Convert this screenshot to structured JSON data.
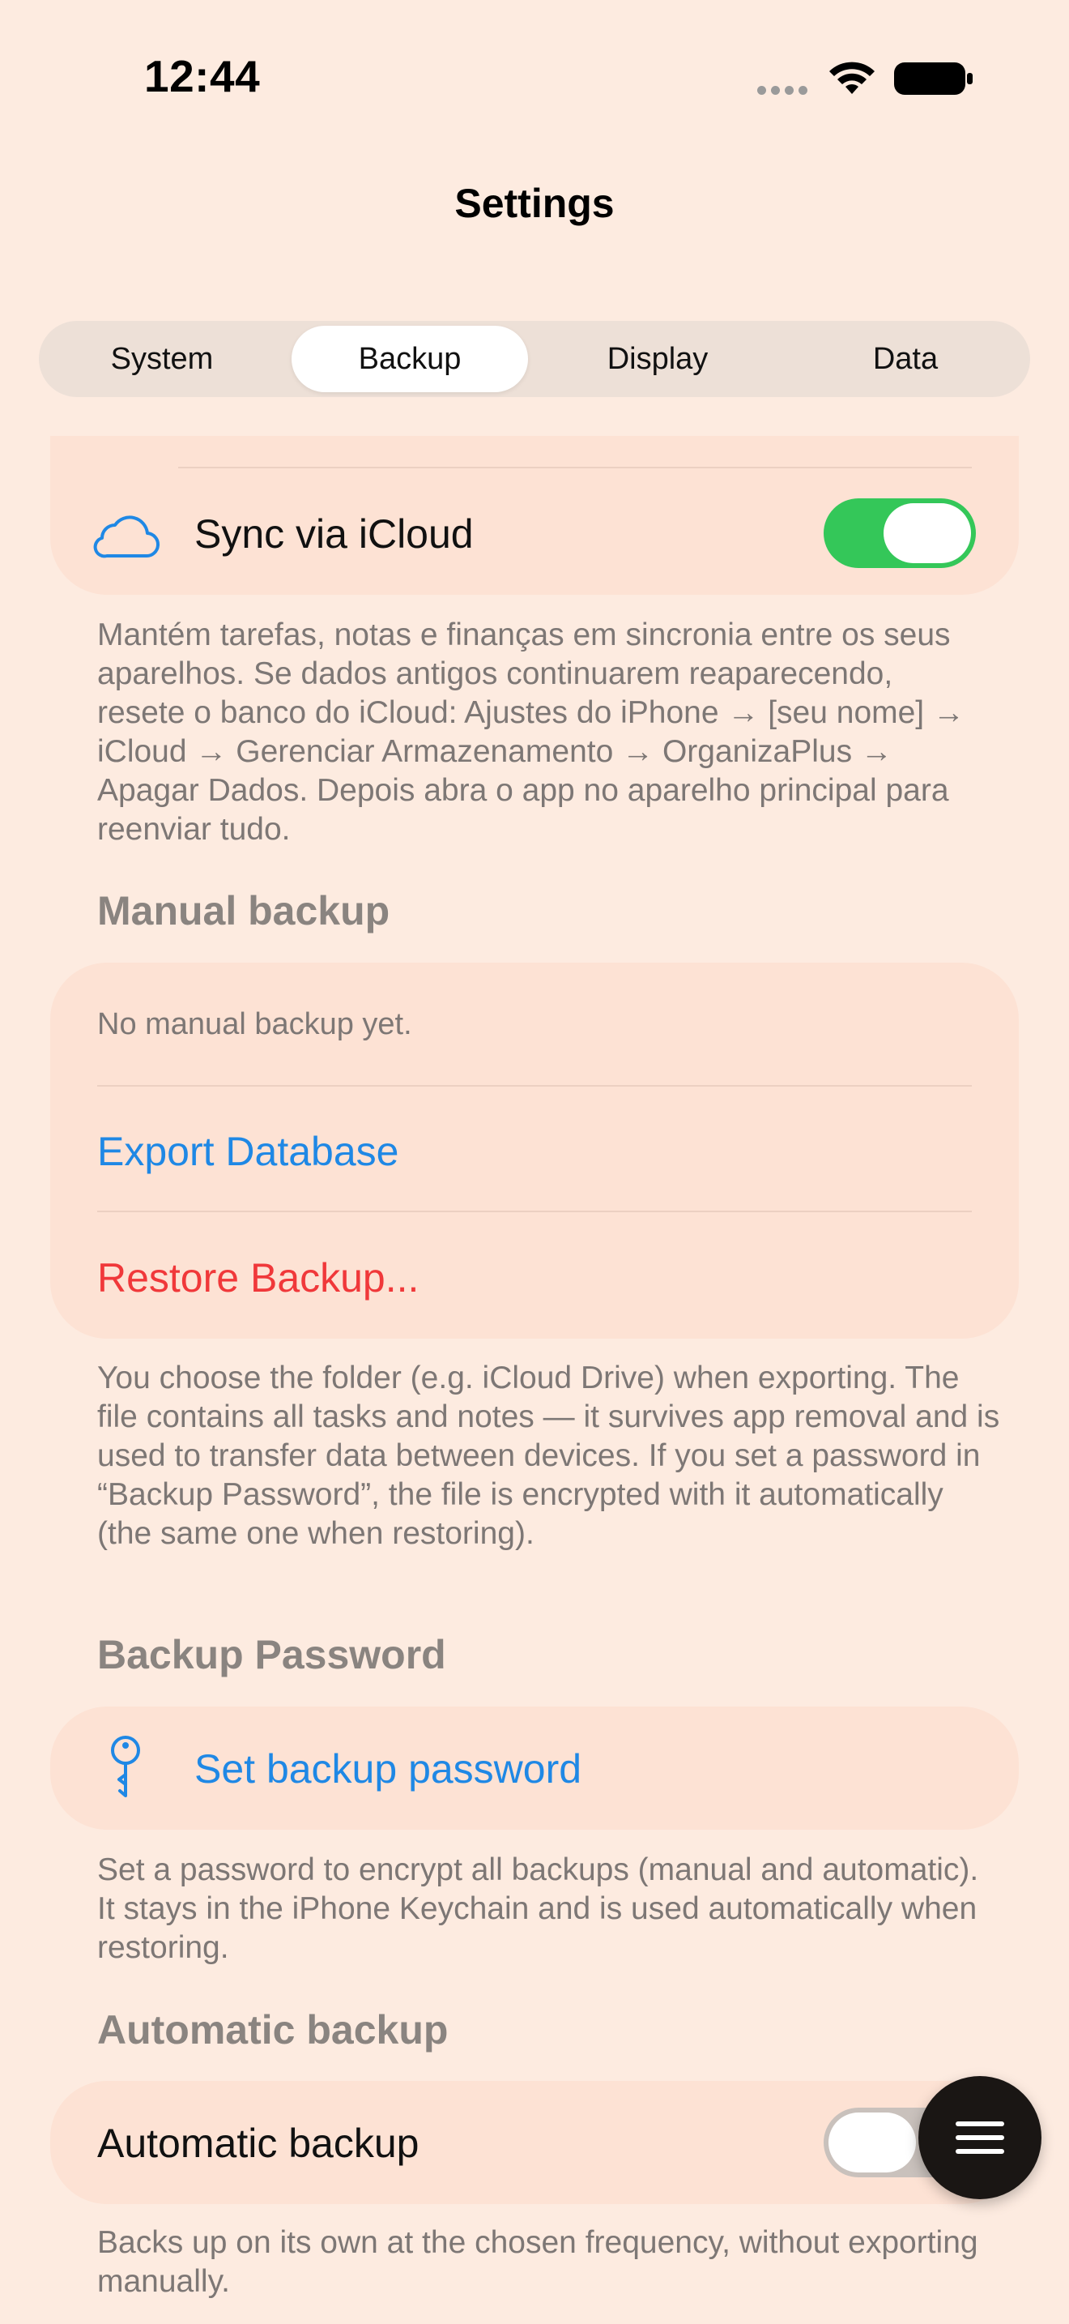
{
  "status_bar": {
    "time": "12:44"
  },
  "nav": {
    "title": "Settings"
  },
  "tabs": [
    {
      "label": "System",
      "active": false
    },
    {
      "label": "Backup",
      "active": true
    },
    {
      "label": "Display",
      "active": false
    },
    {
      "label": "Data",
      "active": false
    }
  ],
  "icloud": {
    "icon": "cloud-icon",
    "label": "Sync via iCloud",
    "toggle_on": true,
    "footnote": "Mantém tarefas, notas e finanças em sincronia entre os seus aparelhos. Se dados antigos continuarem reaparecendo, resete o banco do iCloud: Ajustes do iPhone → [seu nome] → iCloud → Gerenciar Armazenamento → OrganizaPlus → Apagar Dados. Depois abra o app no aparelho principal para reenviar tudo."
  },
  "manual_backup": {
    "header": "Manual backup",
    "status": "No manual backup yet.",
    "export_label": "Export Database",
    "restore_label": "Restore Backup...",
    "footnote": "You choose the folder (e.g. iCloud Drive) when exporting. The file contains all tasks and notes — it survives app removal and is used to transfer data between devices. If you set a password in “Backup Password”, the file is encrypted with it automatically (the same one when restoring)."
  },
  "backup_password": {
    "header": "Backup Password",
    "icon": "key-icon",
    "label": "Set backup password",
    "footnote": "Set a password to encrypt all backups (manual and automatic). It stays in the iPhone Keychain and is used automatically when restoring."
  },
  "automatic_backup": {
    "header": "Automatic backup",
    "label": "Automatic backup",
    "toggle_on": false,
    "footnote": "Backs up on its own at the chosen frequency, without exporting manually."
  },
  "fab": {
    "icon": "menu-icon"
  },
  "colors": {
    "background": "#fdebe0",
    "card": "#fde2d4",
    "accent_blue": "#1f88e5",
    "destructive_red": "#f0383a",
    "toggle_green": "#34c759"
  }
}
